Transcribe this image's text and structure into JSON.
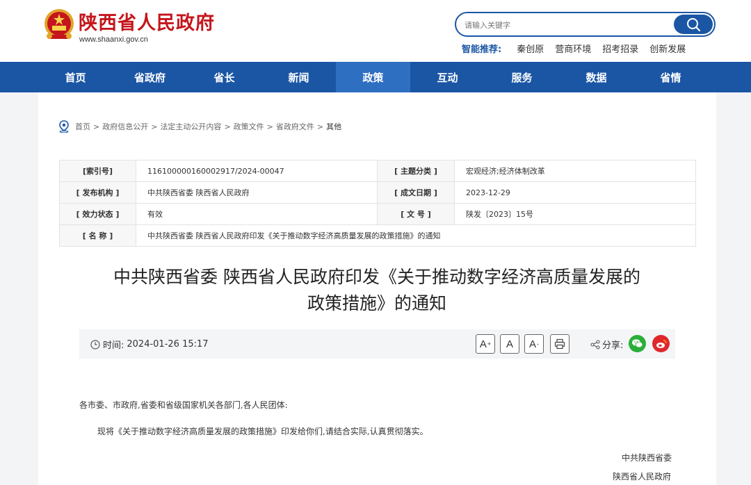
{
  "header": {
    "site_title": "陕西省人民政府",
    "site_domain": "www.shaanxi.gov.cn",
    "search_placeholder": "请输入关键字",
    "recommend_label": "智能推荐:",
    "recommend_items": [
      "秦创原",
      "营商环境",
      "招考招录",
      "创新发展"
    ]
  },
  "nav": {
    "items": [
      "首页",
      "省政府",
      "省长",
      "新闻",
      "政策",
      "互动",
      "服务",
      "数据",
      "省情"
    ],
    "active_index": 4
  },
  "breadcrumb": [
    "首页",
    "政府信息公开",
    "法定主动公开内容",
    "政策文件",
    "省政府文件",
    "其他"
  ],
  "breadcrumb_sep": ">",
  "meta": {
    "index_label": "[索引号]",
    "index_value": "116100000160002917/2024-00047",
    "topic_label": "[ 主题分类 ]",
    "topic_value": "宏观经济;经济体制改革",
    "issuer_label": "[ 发布机构 ]",
    "issuer_value": "中共陕西省委 陕西省人民政府",
    "date_label": "[ 成文日期 ]",
    "date_value": "2023-12-29",
    "status_label": "[ 效力状态 ]",
    "status_value": "有效",
    "docno_label": "[ 文 号 ]",
    "docno_value": "陕发〔2023〕15号",
    "name_label": "[ 名 称 ]",
    "name_value": "中共陕西省委 陕西省人民政府印发《关于推动数字经济高质量发展的政策措施》的通知"
  },
  "article": {
    "title_line1": "中共陕西省委 陕西省人民政府印发《关于推动数字经济高质量发展的",
    "title_line2": "政策措施》的通知",
    "time_label": "时间:",
    "time_value": "2024-01-26 15:17",
    "font_large": "A",
    "font_large_sup": "+",
    "font_normal": "A",
    "font_small": "A",
    "font_small_sup": "-",
    "share_label": "分享:",
    "salutation": "各市委、市政府,省委和省级国家机关各部门,各人民团体:",
    "paragraph1": "现将《关于推动数字经济高质量发展的政策措施》印发给你们,请结合实际,认真贯彻落实。",
    "signature1": "中共陕西省委",
    "signature2": "陕西省人民政府"
  },
  "colors": {
    "brand_blue": "#1b56a5",
    "brand_red": "#c4161c",
    "wechat_green": "#2aae3a",
    "weibo_red": "#e0272c"
  }
}
